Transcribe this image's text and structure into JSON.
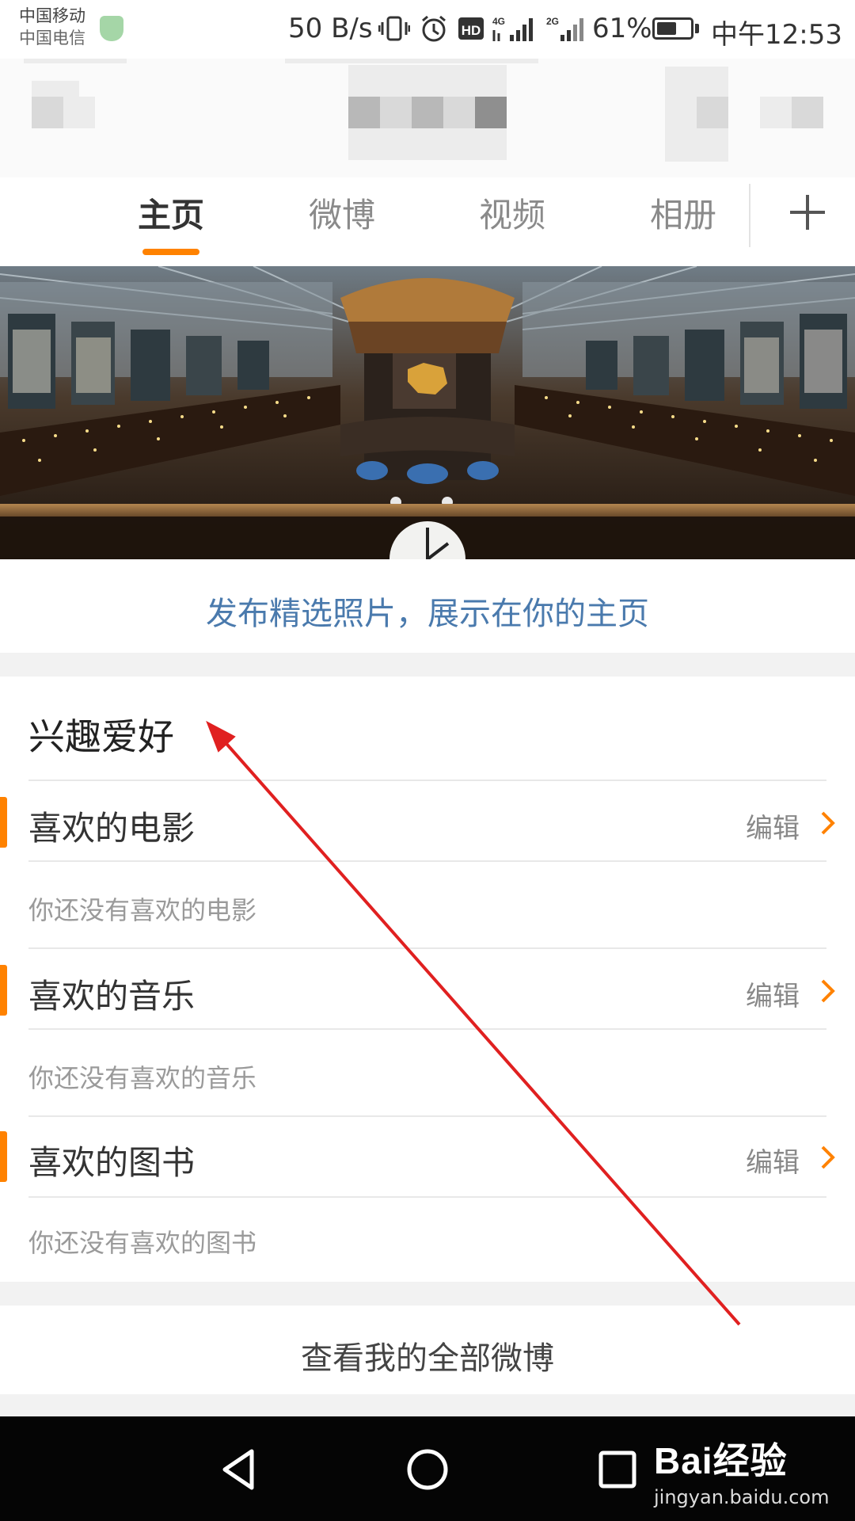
{
  "status_bar": {
    "carrier_1": "中国移动",
    "carrier_2": "中国电信",
    "net_speed": "50 B/s",
    "battery_percent": "61%",
    "battery_level": 0.61,
    "time": "中午12:53",
    "icons": [
      "vibrate-icon",
      "alarm-icon",
      "hd-icon",
      "4g-signal-icon",
      "2g-signal-icon",
      "battery-icon"
    ]
  },
  "tabs": [
    {
      "label": "主页",
      "active": true
    },
    {
      "label": "微博",
      "active": false
    },
    {
      "label": "视频",
      "active": false
    },
    {
      "label": "相册",
      "active": false
    }
  ],
  "promo": {
    "text": "发布精选照片，展示在你的主页"
  },
  "interests": {
    "title": "兴趣爱好",
    "items": [
      {
        "title": "喜欢的电影",
        "edit": "编辑",
        "empty": "你还没有喜欢的电影"
      },
      {
        "title": "喜欢的音乐",
        "edit": "编辑",
        "empty": "你还没有喜欢的音乐"
      },
      {
        "title": "喜欢的图书",
        "edit": "编辑",
        "empty": "你还没有喜欢的图书"
      }
    ]
  },
  "view_all": {
    "label": "查看我的全部微博"
  },
  "watermark": {
    "main": "Bai经验",
    "sub": "jingyan.baidu.com"
  },
  "colors": {
    "accent": "#ff8200",
    "link": "#4a7aad",
    "annotation": "#e02020"
  }
}
